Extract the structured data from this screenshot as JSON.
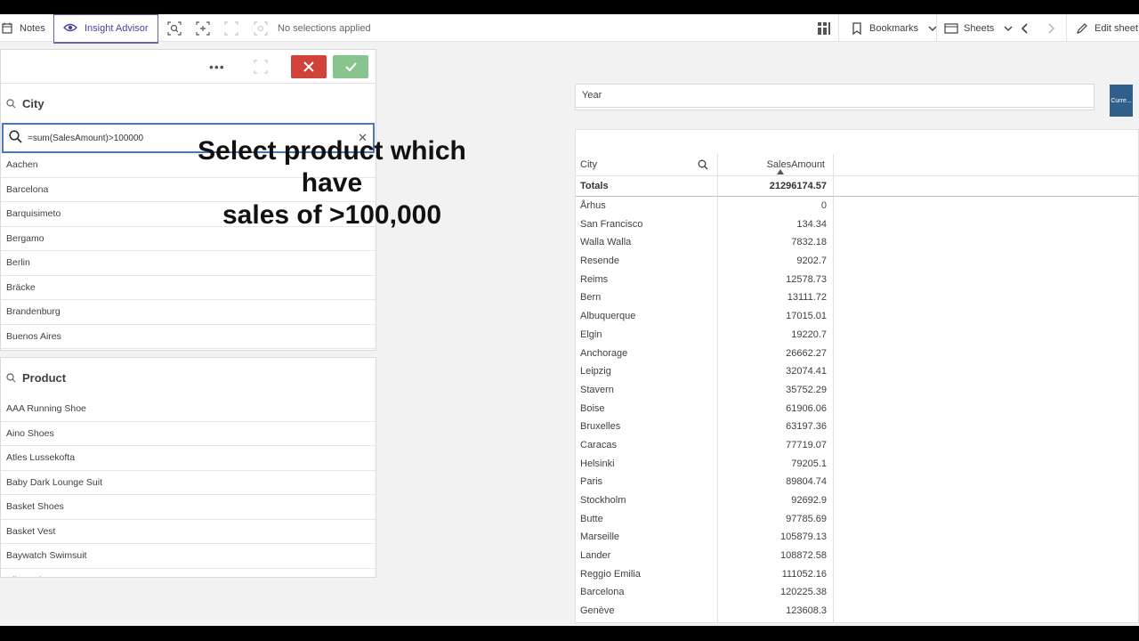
{
  "toolbar": {
    "notes_label": "Notes",
    "insight_label": "Insight Advisor",
    "selections_status": "No selections applied",
    "bookmarks_label": "Bookmarks",
    "sheets_label": "Sheets",
    "edit_label": "Edit sheet"
  },
  "city_filter": {
    "title": "City",
    "search_value": "=sum(SalesAmount)>100000",
    "items": [
      "Aachen",
      "Barcelona",
      "Barquisimeto",
      "Bergamo",
      "Berlin",
      "Bräcke",
      "Brandenburg",
      "Buenos Aires"
    ]
  },
  "product_filter": {
    "title": "Product",
    "items": [
      "AAA Running Shoe",
      "Aino Shoes",
      "Atles Lussekofta",
      "Baby Dark Lounge Suit",
      "Basket Shoes",
      "Basket Vest",
      "Baywatch Swimsuit",
      "Bike Helmet"
    ]
  },
  "overlay": {
    "line1": "Select product which have",
    "line2": "sales of >100,000"
  },
  "year_filter": {
    "title": "Year"
  },
  "current_button": {
    "label": "Curre..."
  },
  "table": {
    "col_city": "City",
    "col_sales": "SalesAmount",
    "totals_label": "Totals",
    "totals_value": "21296174.57",
    "rows": [
      {
        "city": "Århus",
        "sales": "0"
      },
      {
        "city": "San Francisco",
        "sales": "134.34"
      },
      {
        "city": "Walla Walla",
        "sales": "7832.18"
      },
      {
        "city": "Resende",
        "sales": "9202.7"
      },
      {
        "city": "Reims",
        "sales": "12578.73"
      },
      {
        "city": "Bern",
        "sales": "13111.72"
      },
      {
        "city": "Albuquerque",
        "sales": "17015.01"
      },
      {
        "city": "Elgin",
        "sales": "19220.7"
      },
      {
        "city": "Anchorage",
        "sales": "26662.27"
      },
      {
        "city": "Leipzig",
        "sales": "32074.41"
      },
      {
        "city": "Stavern",
        "sales": "35752.29"
      },
      {
        "city": "Boise",
        "sales": "61906.06"
      },
      {
        "city": "Bruxelles",
        "sales": "63197.36"
      },
      {
        "city": "Caracas",
        "sales": "77719.07"
      },
      {
        "city": "Helsinki",
        "sales": "79205.1"
      },
      {
        "city": "Paris",
        "sales": "89804.74"
      },
      {
        "city": "Stockholm",
        "sales": "92692.9"
      },
      {
        "city": "Butte",
        "sales": "97785.69"
      },
      {
        "city": "Marseille",
        "sales": "105879.13"
      },
      {
        "city": "Lander",
        "sales": "108872.58"
      },
      {
        "city": "Reggio Emilia",
        "sales": "111052.16"
      },
      {
        "city": "Barcelona",
        "sales": "120225.38"
      },
      {
        "city": "Genève",
        "sales": "123608.3"
      }
    ]
  }
}
